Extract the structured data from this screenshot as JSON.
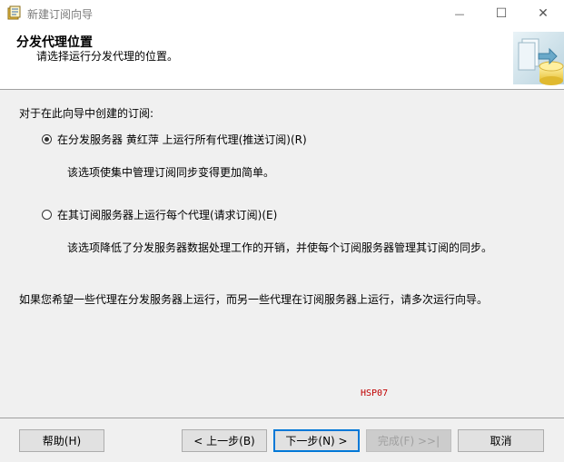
{
  "window": {
    "title": "新建订阅向导",
    "minimize_glyph": "—",
    "maximize_glyph": "☐",
    "close_glyph": "✕"
  },
  "header": {
    "title": "分发代理位置",
    "subtitle": "请选择运行分发代理的位置。"
  },
  "body": {
    "intro": "对于在此向导中创建的订阅:",
    "options": [
      {
        "label": "在分发服务器 黄红萍 上运行所有代理(推送订阅)(R)",
        "description": "该选项使集中管理订阅同步变得更加简单。",
        "selected": true
      },
      {
        "label": "在其订阅服务器上运行每个代理(请求订阅)(E)",
        "description": "该选项降低了分发服务器数据处理工作的开销，并使每个订阅服务器管理其订阅的同步。",
        "selected": false
      }
    ],
    "note": "如果您希望一些代理在分发服务器上运行，而另一些代理在订阅服务器上运行，请多次运行向导。",
    "server_code": "HSP07"
  },
  "footer": {
    "help": "帮助(H)",
    "back": "< 上一步(B)",
    "next": "下一步(N) >",
    "finish": "完成(F) >>|",
    "cancel": "取消"
  }
}
